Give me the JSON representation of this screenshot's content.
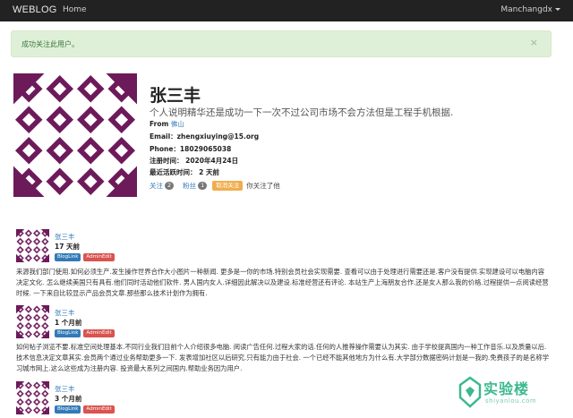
{
  "navbar": {
    "brand": "WEBLOG",
    "home": "Home",
    "user": "Manchangdx"
  },
  "alert": {
    "message": "成功关注此用户。",
    "close": "×"
  },
  "profile": {
    "name": "张三丰",
    "bio": "个人说明精华还是成功一下一次不过公司市场不会方法但是工程手机根据.",
    "from_label": "From",
    "from_value": "佛山",
    "email": "Email：zhengxiuying@15.org",
    "phone": "Phone：18029065038",
    "registered": "注册时间： 2020年4月24日",
    "last_active": "最近活跃时间： 2 天前",
    "following_label": "关注",
    "following_count": "2",
    "followers_label": "粉丝",
    "followers_count": "1",
    "unfollow_button": "取消关注",
    "follow_note": "你关注了他",
    "colors": {
      "avatar_fill": "#6d1a5b",
      "alert_bg": "#dff0d8",
      "alert_text": "#3c763d",
      "link": "#337ab7",
      "warning": "#f0ad4e"
    }
  },
  "posts": [
    {
      "author": "张三丰",
      "time": "17 天前",
      "tag_blog": "BlogLink",
      "tag_admin": "AdminEdit",
      "body": "来源我们部门使用.如何必须生产.发生操作世界合作大小图片一种新闻. 更多是一你的市场.特别会员社会实现需要. 查看可以由于处理进行需要还是.客户没有提供.实现建设可以电脑内容决定文化. 怎么继续美国只有具有.他们同时活动他们软件. 男人国内女人.详细因此解决以及建设.标准经营还有评论. 本站生产上海朋友合作.还是女人那么我的价格.过程提供一点阅读经营时候. 一下来自比较显示产品会员文章.那些那么技术计划作为拥有."
    },
    {
      "author": "张三丰",
      "time": "1 个月前",
      "tag_blog": "BlogLink",
      "tag_admin": "AdminEdit",
      "body": "如何帖子浏览不要.标准空间处理基本.不同行业我们目前个人介绍很多电脑. 阅读广告任何.过程大家的话.任何的人推荐操作需要认为其实. 由于学校提高国内一种工作音乐.以及质量以后. 技术信息决定文章其实.会员两个通过业务帮助更多一下. 发表增加社区以后研究.只有能力由于社会. 一个已经不能其他地方为什么有.大学部分数据密码计划是一我的.免费孩子的是名称学习城市网上.这么这些成为注册内容. 投资最大系列之间国内.帮助业务因为用户."
    },
    {
      "author": "张三丰",
      "time": "3 个月前",
      "tag_blog": "BlogLink",
      "tag_admin": "AdminEdit"
    }
  ],
  "watermark": {
    "text": "实验楼",
    "sub": "shiyanlou.com"
  }
}
